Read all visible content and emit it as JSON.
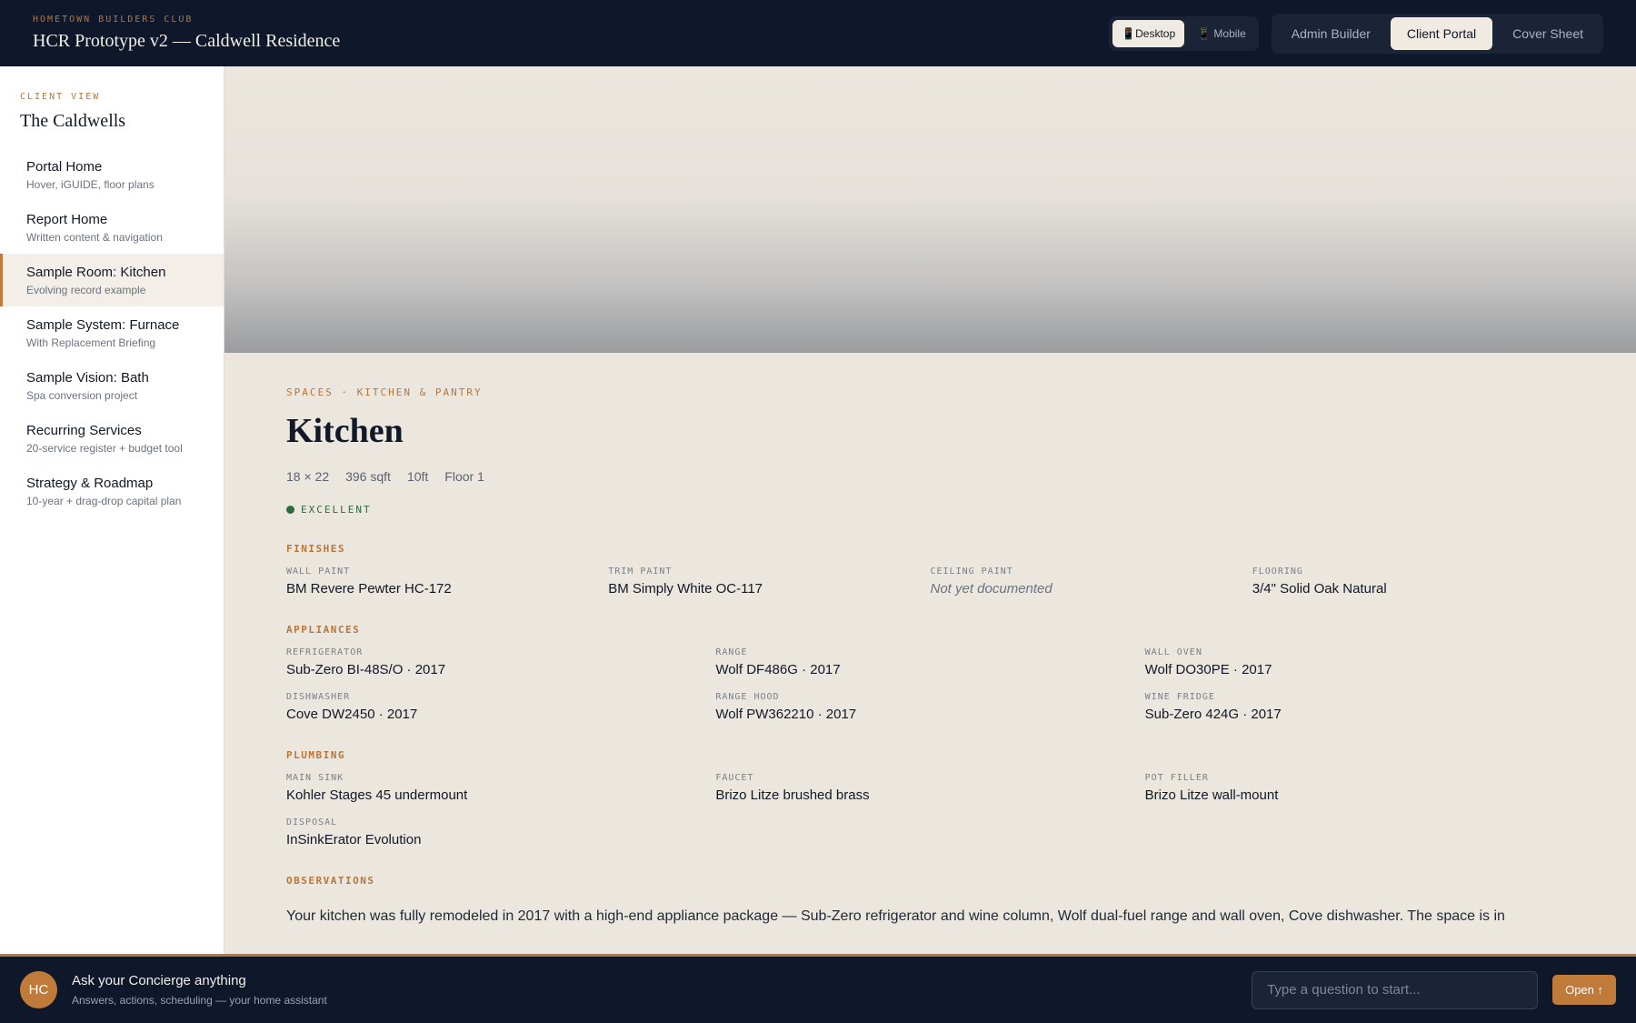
{
  "header": {
    "org": "HOMETOWN BUILDERS CLUB",
    "title": "HCR Prototype v2 — Caldwell Residence",
    "device_toggle": [
      "📱Desktop",
      "📱 Mobile"
    ],
    "view_tabs": [
      "Admin Builder",
      "Client Portal",
      "Cover Sheet"
    ],
    "active_view": "Client Portal",
    "active_device": "Desktop"
  },
  "sidebar": {
    "kicker": "CLIENT VIEW",
    "client_name": "The Caldwells",
    "items": [
      {
        "title": "Portal Home",
        "sub": "Hover, iGUIDE, floor plans"
      },
      {
        "title": "Report Home",
        "sub": "Written content & navigation"
      },
      {
        "title": "Sample Room: Kitchen",
        "sub": "Evolving record example"
      },
      {
        "title": "Sample System: Furnace",
        "sub": "With Replacement Briefing"
      },
      {
        "title": "Sample Vision: Bath",
        "sub": "Spa conversion project"
      },
      {
        "title": "Recurring Services",
        "sub": "20-service register + budget tool"
      },
      {
        "title": "Strategy & Roadmap",
        "sub": "10-year + drag-drop capital plan"
      }
    ],
    "active_index": 2
  },
  "room": {
    "breadcrumb": "SPACES · KITCHEN & PANTRY",
    "name": "Kitchen",
    "meta": [
      "18 × 22",
      "396 sqft",
      "10ft",
      "Floor 1"
    ],
    "condition": "EXCELLENT",
    "condition_color": "#2f6b3a",
    "finishes_label": "FINISHES",
    "finishes": [
      {
        "label": "WALL PAINT",
        "value": "BM Revere Pewter HC-172"
      },
      {
        "label": "TRIM PAINT",
        "value": "BM Simply White OC-117"
      },
      {
        "label": "CEILING PAINT",
        "value": "Not yet documented"
      },
      {
        "label": "FLOORING",
        "value": "3/4\" Solid Oak Natural"
      }
    ],
    "appliances_label": "APPLIANCES",
    "appliances": [
      {
        "label": "REFRIGERATOR",
        "value": "Sub-Zero BI-48S/O · 2017"
      },
      {
        "label": "RANGE",
        "value": "Wolf DF486G · 2017"
      },
      {
        "label": "WALL OVEN",
        "value": "Wolf DO30PE · 2017"
      },
      {
        "label": "DISHWASHER",
        "value": "Cove DW2450 · 2017"
      },
      {
        "label": "RANGE HOOD",
        "value": "Wolf PW362210 · 2017"
      },
      {
        "label": "WINE FRIDGE",
        "value": "Sub-Zero 424G · 2017"
      }
    ],
    "plumbing_label": "PLUMBING",
    "plumbing": [
      {
        "label": "MAIN SINK",
        "value": "Kohler Stages 45 undermount"
      },
      {
        "label": "FAUCET",
        "value": "Brizo Litze brushed brass"
      },
      {
        "label": "POT FILLER",
        "value": "Brizo Litze wall-mount"
      },
      {
        "label": "DISPOSAL",
        "value": "InSinkErator Evolution"
      }
    ],
    "observations_label": "OBSERVATIONS",
    "observations": "Your kitchen was fully remodeled in 2017 with a high-end appliance package — Sub-Zero refrigerator and wine column, Wolf dual-fuel range and wall oven, Cove dishwasher. The space is in"
  },
  "concierge": {
    "avatar": "HC",
    "title": "Ask your Concierge anything",
    "subtitle": "Answers, actions, scheduling — your home assistant",
    "placeholder": "Type a question to start...",
    "button": "Open ↑"
  },
  "colors": {
    "accent": "#b8763a",
    "navy": "#0f172a",
    "background": "#ebe6de"
  }
}
